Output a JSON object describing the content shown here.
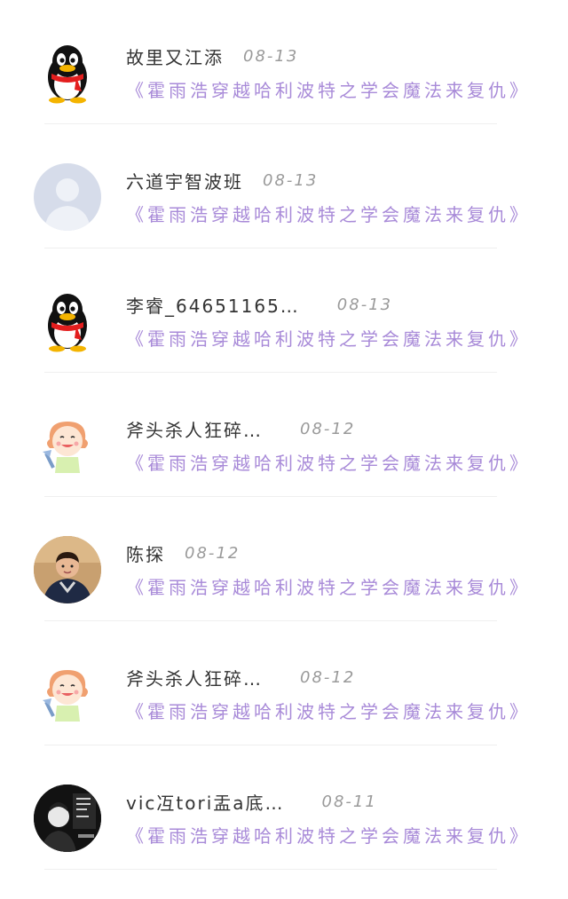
{
  "comments": [
    {
      "name": "故里又江添",
      "date": "08-13",
      "title": "《霍雨浩穿越哈利波特之学会魔法来复仇》",
      "avatar": "qq-penguin-icon"
    },
    {
      "name": "六道宇智波班",
      "date": "08-13",
      "title": "《霍雨浩穿越哈利波特之学会魔法来复仇》",
      "avatar": "default-user-icon"
    },
    {
      "name": "李睿_64651165…",
      "date": "08-13",
      "title": "《霍雨浩穿越哈利波特之学会魔法来复仇》",
      "avatar": "qq-penguin-icon"
    },
    {
      "name": "斧头杀人狂碎…",
      "date": "08-12",
      "title": "《霍雨浩穿越哈利波特之学会魔法来复仇》",
      "avatar": "cartoon-boy-icon"
    },
    {
      "name": "陈探",
      "date": "08-12",
      "title": "《霍雨浩穿越哈利波特之学会魔法来复仇》",
      "avatar": "photo-avatar"
    },
    {
      "name": "斧头杀人狂碎…",
      "date": "08-12",
      "title": "《霍雨浩穿越哈利波特之学会魔法来复仇》",
      "avatar": "cartoon-boy-icon"
    },
    {
      "name": "vic冱tori盂a底…",
      "date": "08-11",
      "title": "《霍雨浩穿越哈利波特之学会魔法来复仇》",
      "avatar": "dark-photo-avatar"
    }
  ],
  "colors": {
    "title": "#a88ad8",
    "name": "#333333",
    "date": "#9a9a9a",
    "divider": "#efefef"
  }
}
